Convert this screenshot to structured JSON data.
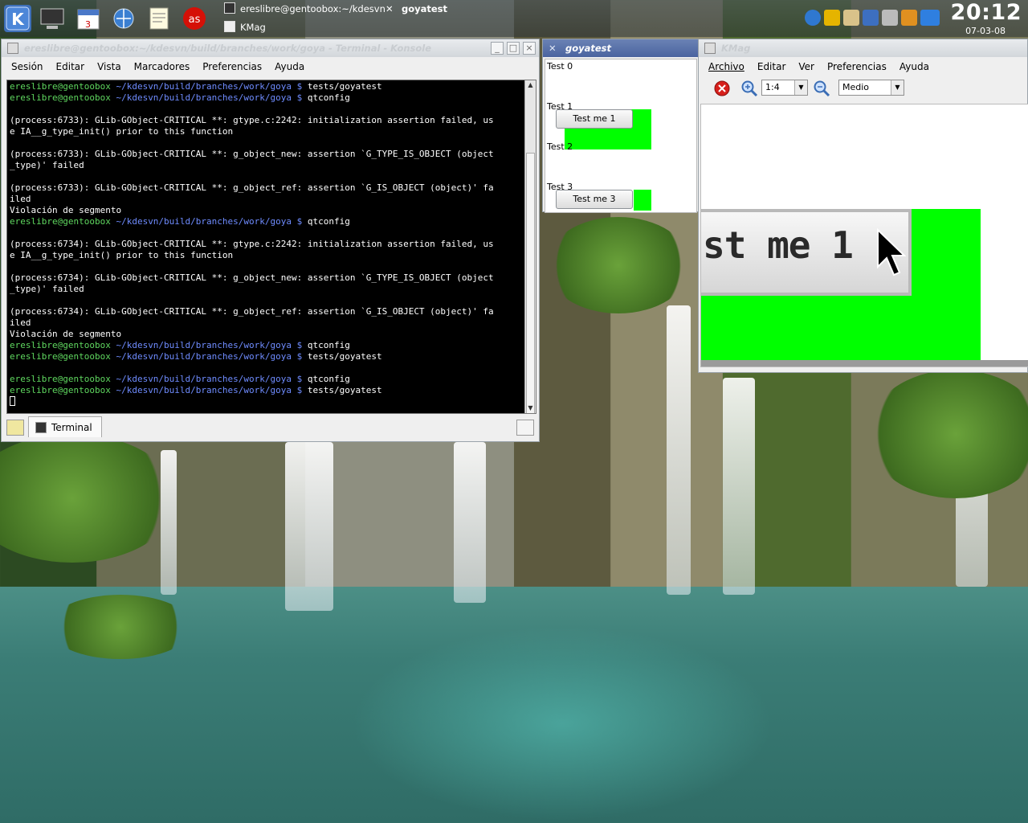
{
  "taskbar": {
    "tasks": [
      {
        "label": "ereslibre@gentoobox:~/kdesvn"
      },
      {
        "label": "goyatest"
      },
      {
        "label": "KMag"
      }
    ],
    "clock": "20:12",
    "date": "07-03-08"
  },
  "konsole": {
    "title": "ereslibre@gentoobox:~/kdesvn/build/branches/work/goya - Terminal - Konsole",
    "menu": [
      "Sesión",
      "Editar",
      "Vista",
      "Marcadores",
      "Preferencias",
      "Ayuda"
    ],
    "prompt_user": "ereslibre@gentoobox",
    "prompt_path": "~/kdesvn/build/branches/work/goya $",
    "lines": [
      {
        "type": "prompt",
        "cmd": "tests/goyatest"
      },
      {
        "type": "prompt",
        "cmd": "qtconfig"
      },
      {
        "type": "text",
        "text": ""
      },
      {
        "type": "text",
        "text": "(process:6733): GLib-GObject-CRITICAL **: gtype.c:2242: initialization assertion failed, us"
      },
      {
        "type": "text",
        "text": "e IA__g_type_init() prior to this function"
      },
      {
        "type": "text",
        "text": ""
      },
      {
        "type": "text",
        "text": "(process:6733): GLib-GObject-CRITICAL **: g_object_new: assertion `G_TYPE_IS_OBJECT (object"
      },
      {
        "type": "text",
        "text": "_type)' failed"
      },
      {
        "type": "text",
        "text": ""
      },
      {
        "type": "text",
        "text": "(process:6733): GLib-GObject-CRITICAL **: g_object_ref: assertion `G_IS_OBJECT (object)' fa"
      },
      {
        "type": "text",
        "text": "iled"
      },
      {
        "type": "text",
        "text": "Violación de segmento"
      },
      {
        "type": "prompt",
        "cmd": "qtconfig"
      },
      {
        "type": "text",
        "text": ""
      },
      {
        "type": "text",
        "text": "(process:6734): GLib-GObject-CRITICAL **: gtype.c:2242: initialization assertion failed, us"
      },
      {
        "type": "text",
        "text": "e IA__g_type_init() prior to this function"
      },
      {
        "type": "text",
        "text": ""
      },
      {
        "type": "text",
        "text": "(process:6734): GLib-GObject-CRITICAL **: g_object_new: assertion `G_TYPE_IS_OBJECT (object"
      },
      {
        "type": "text",
        "text": "_type)' failed"
      },
      {
        "type": "text",
        "text": ""
      },
      {
        "type": "text",
        "text": "(process:6734): GLib-GObject-CRITICAL **: g_object_ref: assertion `G_IS_OBJECT (object)' fa"
      },
      {
        "type": "text",
        "text": "iled"
      },
      {
        "type": "text",
        "text": "Violación de segmento"
      },
      {
        "type": "prompt",
        "cmd": "qtconfig"
      },
      {
        "type": "prompt",
        "cmd": "tests/goyatest"
      },
      {
        "type": "text",
        "text": ""
      },
      {
        "type": "prompt",
        "cmd": "qtconfig"
      },
      {
        "type": "prompt",
        "cmd": "tests/goyatest"
      },
      {
        "type": "cursor",
        "text": ""
      }
    ],
    "tab_label": "Terminal"
  },
  "goyatest": {
    "title": "goyatest",
    "labels": [
      "Test 0",
      "Test 1",
      "Test 2",
      "Test 3"
    ],
    "button1": "Test me 1",
    "button3": "Test me 3"
  },
  "kmag": {
    "title": "KMag",
    "menu": [
      "Archivo",
      "Editar",
      "Ver",
      "Preferencias",
      "Ayuda"
    ],
    "zoom_value": "1:4",
    "refresh_value": "Medio",
    "magnified_text": "st me 1"
  }
}
